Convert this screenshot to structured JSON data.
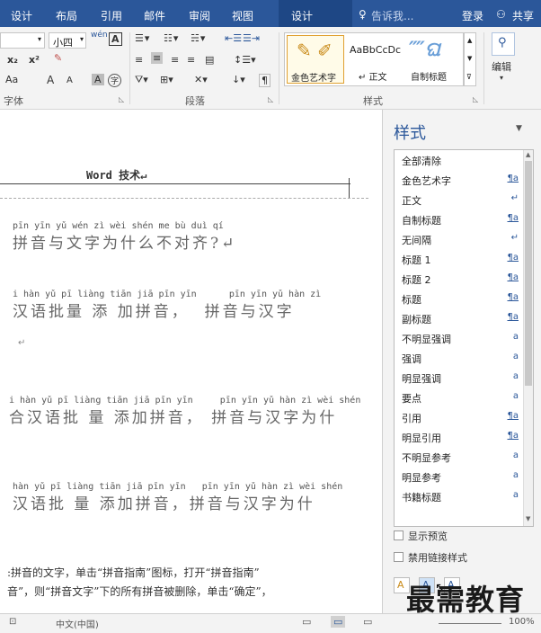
{
  "tabs": {
    "design": "设计",
    "layout": "布局",
    "references": "引用",
    "mailings": "邮件",
    "review": "审阅",
    "view": "视图",
    "context_design": "设计",
    "tell_me": "告诉我...",
    "login": "登录",
    "share": "共享"
  },
  "ribbon": {
    "font_size": "小四",
    "wen_btn": "wén",
    "A_box": "A",
    "x2_sub": "x₂",
    "x2_sup": "x²",
    "aa": "Aa",
    "grow": "A",
    "shrink": "A",
    "char_shade": "A",
    "enclose": "字",
    "font_group": "字体",
    "para_group": "段落",
    "styles_group": "样式",
    "edit_label": "编辑",
    "gallery": [
      {
        "preview": "",
        "label": "金色艺术字"
      },
      {
        "preview": "AaBbCcDc",
        "label": "↵ 正文"
      },
      {
        "preview": "",
        "label": "自制标题"
      }
    ]
  },
  "doc": {
    "heading": "Word 技术↵",
    "lines": [
      {
        "py": "pīn yīn yǔ wén zì wèi shén me bù duì qí",
        "cn": "拼音与文字为什么不对齐?↵"
      },
      {
        "py": "i hàn yǔ pī liàng tiān jiā pīn yīn      pīn yīn yǔ hàn zì",
        "cn": "汉语批量 添 加拼音，  拼音与汉字"
      },
      {
        "py": "",
        "cn": "↵"
      },
      {
        "py": "i hàn yǔ pī liàng tiān jiā pīn yīn     pīn yīn yǔ hàn zì wèi shén",
        "cn": "合汉语批 量 添加拼音， 拼音与汉字为什"
      },
      {
        "py": "hàn yǔ pī liàng tiān jiā pīn yīn   pīn yīn yǔ hàn zì wèi shén",
        "cn": "汉语批 量 添加拼音，拼音与汉字为什"
      }
    ],
    "body1": ":拼音的文字，单击“拼音指南”图标，打开“拼音指南”",
    "body2": "音”，则“拼音文字”下的所有拼音被删除，单击“确定”，"
  },
  "styles_pane": {
    "title": "样式",
    "items": [
      {
        "name": "全部清除",
        "icon": ""
      },
      {
        "name": "金色艺术字",
        "icon": "¶a"
      },
      {
        "name": "正文",
        "icon": "↵"
      },
      {
        "name": "自制标题",
        "icon": "¶a"
      },
      {
        "name": "无间隔",
        "icon": "↵"
      },
      {
        "name": "标题 1",
        "icon": "¶a"
      },
      {
        "name": "标题 2",
        "icon": "¶a"
      },
      {
        "name": "标题",
        "icon": "¶a"
      },
      {
        "name": "副标题",
        "icon": "¶a"
      },
      {
        "name": "不明显强调",
        "icon": "a"
      },
      {
        "name": "强调",
        "icon": "a"
      },
      {
        "name": "明显强调",
        "icon": "a"
      },
      {
        "name": "要点",
        "icon": "a"
      },
      {
        "name": "引用",
        "icon": "¶a"
      },
      {
        "name": "明显引用",
        "icon": "¶a"
      },
      {
        "name": "不明显参考",
        "icon": "a"
      },
      {
        "name": "明显参考",
        "icon": "a"
      },
      {
        "name": "书籍标题",
        "icon": "a"
      }
    ],
    "show_preview": "显示预览",
    "disable_linked": "禁用链接样式"
  },
  "status": {
    "language": "中文(中国)",
    "zoom": "100%"
  },
  "watermark": "最需教育",
  "colors": {
    "accent": "#2b579a"
  }
}
